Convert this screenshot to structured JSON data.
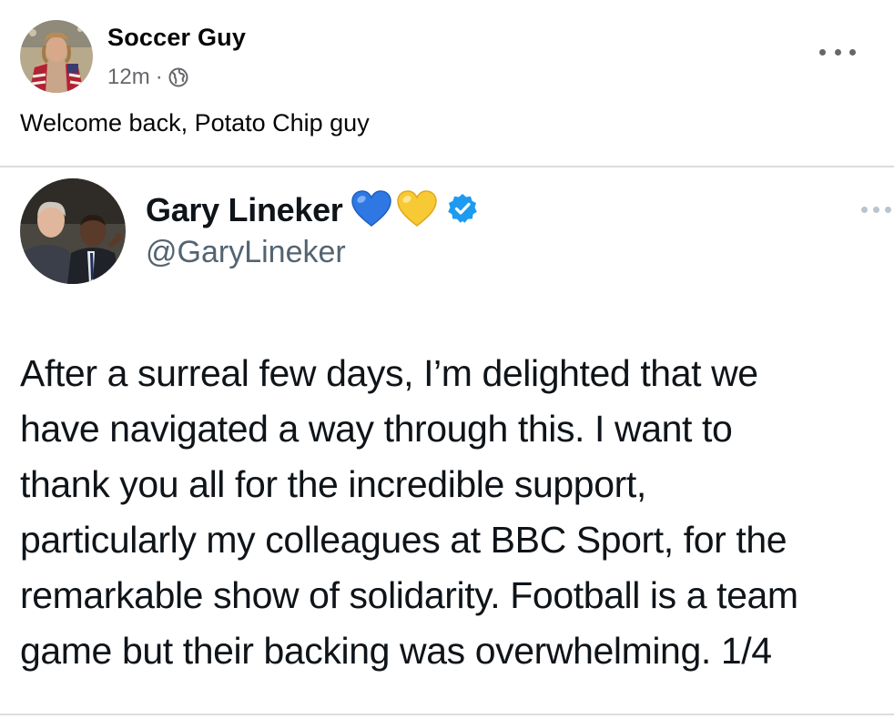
{
  "post": {
    "author": "Soccer Guy",
    "timestamp": "12m",
    "separator": "·",
    "audience_icon": "globe-icon",
    "more_icon": "more-options-icon",
    "caption": "Welcome back, Potato Chip guy"
  },
  "tweet": {
    "display_name": "Gary Lineker",
    "name_emojis": [
      "blue-heart-icon",
      "yellow-heart-icon"
    ],
    "verified_icon": "verified-badge-icon",
    "handle": "@GaryLineker",
    "more_icon": "more-options-icon",
    "lines": [
      "After a surreal few days, I’m delighted that we",
      "have navigated a way through this. I want to",
      "thank you all for the incredible support,",
      "particularly my colleagues at BBC Sport, for the",
      "remarkable show of solidarity. Football is a team",
      "game but their backing was overwhelming. 1/4"
    ]
  },
  "colors": {
    "primary_text": "#050505",
    "secondary_text": "#65676b",
    "tweet_text": "#0f1419",
    "tweet_handle": "#536471",
    "verified_blue": "#1d9bf0",
    "divider": "#dadde1"
  }
}
